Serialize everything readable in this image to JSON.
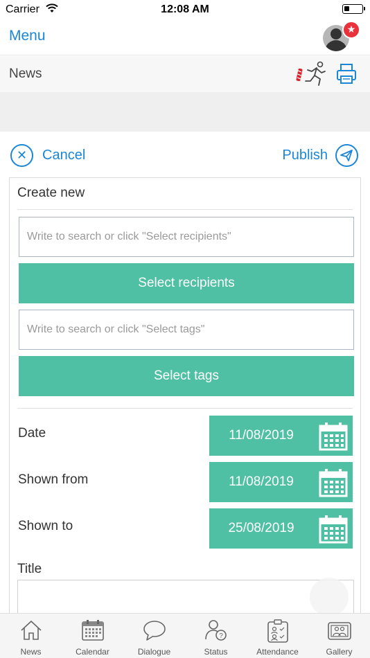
{
  "status_bar": {
    "carrier": "Carrier",
    "time": "12:08 AM"
  },
  "nav": {
    "menu_label": "Menu",
    "badge_icon": "star-icon"
  },
  "header": {
    "title": "News"
  },
  "actions": {
    "cancel_label": "Cancel",
    "publish_label": "Publish"
  },
  "form": {
    "heading": "Create new",
    "recipients_placeholder": "Write to search or click \"Select recipients\"",
    "select_recipients_label": "Select recipients",
    "tags_placeholder": "Write to search or click \"Select tags\"",
    "select_tags_label": "Select tags",
    "dates": [
      {
        "label": "Date",
        "value": "11/08/2019"
      },
      {
        "label": "Shown from",
        "value": "11/08/2019"
      },
      {
        "label": "Shown to",
        "value": "25/08/2019"
      }
    ],
    "title_label": "Title",
    "title_value": ""
  },
  "tabs": [
    {
      "label": "News",
      "icon": "home-icon"
    },
    {
      "label": "Calendar",
      "icon": "calendar-icon"
    },
    {
      "label": "Dialogue",
      "icon": "speech-bubble-icon"
    },
    {
      "label": "Status",
      "icon": "person-question-icon"
    },
    {
      "label": "Attendance",
      "icon": "clipboard-people-icon"
    },
    {
      "label": "Gallery",
      "icon": "photo-gallery-icon"
    }
  ],
  "colors": {
    "accent_blue": "#1a86d8",
    "button_green": "#4fc0a3",
    "badge_red": "#e8323c"
  }
}
